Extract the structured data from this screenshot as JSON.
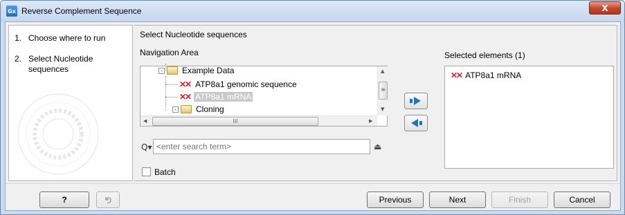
{
  "window": {
    "title": "Reverse Complement Sequence",
    "app_icon_text": "Gx",
    "close_label": "X"
  },
  "steps": [
    {
      "num": "1.",
      "label": "Choose where to run"
    },
    {
      "num": "2.",
      "label": "Select Nucleotide sequences"
    }
  ],
  "main": {
    "heading": "Select Nucleotide sequences",
    "nav_label": "Navigation Area",
    "tree": [
      {
        "label": "Example Data",
        "icon": "folder-icon",
        "expander": "-"
      },
      {
        "label": "ATP8a1 genomic sequence",
        "icon": "dna-sequence-icon"
      },
      {
        "label": "ATP8a1 mRNA",
        "icon": "dna-sequence-icon",
        "selected": true
      },
      {
        "label": "Cloning",
        "icon": "folder-icon",
        "expander": "-"
      }
    ],
    "search_placeholder": "<enter search term>",
    "batch_label": "Batch",
    "selected_heading": "Selected elements (1)",
    "selected_items": [
      {
        "label": "ATP8a1 mRNA",
        "icon": "dna-sequence-icon"
      }
    ],
    "accent_color": "#1e73c8",
    "dna_icon_color": "#d22222"
  },
  "footer": {
    "help_label": "?",
    "previous_label": "Previous",
    "next_label": "Next",
    "finish_label": "Finish",
    "cancel_label": "Cancel"
  }
}
